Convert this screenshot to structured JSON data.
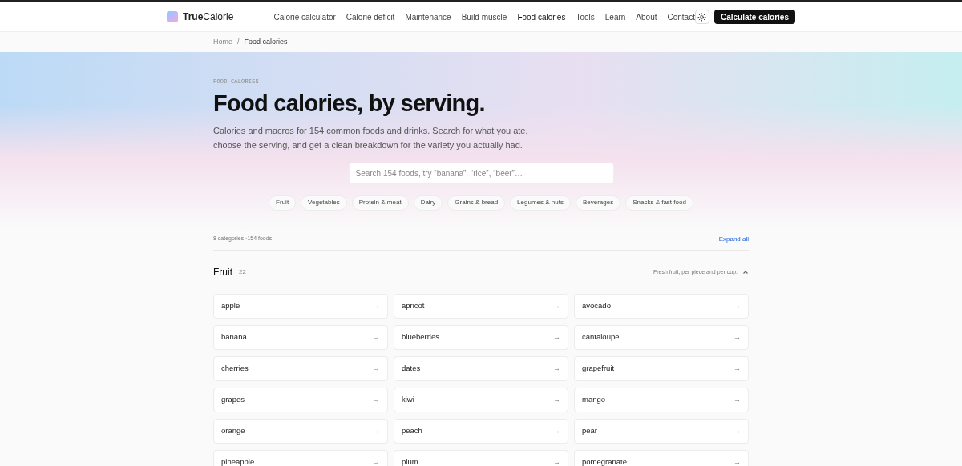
{
  "header": {
    "logo": "**True**Calorie",
    "nav": [
      {
        "label": "Calorie calculator",
        "selected": false
      },
      {
        "label": "Calorie deficit",
        "selected": false
      },
      {
        "label": "Maintenance",
        "selected": false
      },
      {
        "label": "Build muscle",
        "selected": false
      },
      {
        "label": "Food calories",
        "selected": true
      },
      {
        "label": "Tools",
        "selected": false
      },
      {
        "label": "Learn",
        "selected": false
      },
      {
        "label": "About",
        "selected": false
      },
      {
        "label": "Contact",
        "selected": false
      }
    ],
    "cta": "Calculate calories"
  },
  "breadcrumb": [
    "Home",
    "/",
    "Food calories"
  ],
  "hero": {
    "eyebrow": "FOOD CALORIES",
    "title": "Food calories, by serving.",
    "description": "Calories and macros for 154 common foods and drinks. Search for what you ate, choose the serving, and get a clean breakdown for the variety you actually had.",
    "search": {
      "placeholder": "Search 154 foods, try “banana”, “rice”, “beer”…"
    },
    "filters": [
      "Fruit",
      "Vegetables",
      "Protein & meat",
      "Dairy",
      "Grains & bread",
      "Legumes & nuts",
      "Beverages",
      "Snacks & fast food"
    ]
  },
  "summary": {
    "text": "8 categories ·154 foods",
    "action": "Expand all"
  },
  "categories": [
    {
      "name": "Fruit",
      "count": "22",
      "description": "Fresh fruit, per piece and per cup.",
      "expanded": true,
      "items": [
        {
          "label": "apple",
          "arrow": "→"
        },
        {
          "label": "apricot",
          "arrow": "→"
        },
        {
          "label": "avocado",
          "arrow": "→"
        },
        {
          "label": "banana",
          "arrow": "→"
        },
        {
          "label": "blueberries",
          "arrow": "→"
        },
        {
          "label": "cantaloupe",
          "arrow": "→"
        },
        {
          "label": "cherries",
          "arrow": "→"
        },
        {
          "label": "dates",
          "arrow": "→"
        },
        {
          "label": "grapefruit",
          "arrow": "→"
        },
        {
          "label": "grapes",
          "arrow": "→"
        },
        {
          "label": "kiwi",
          "arrow": "→"
        },
        {
          "label": "mango",
          "arrow": "→"
        },
        {
          "label": "orange",
          "arrow": "→"
        },
        {
          "label": "peach",
          "arrow": "→"
        },
        {
          "label": "pear",
          "arrow": "→"
        },
        {
          "label": "pineapple",
          "arrow": "→"
        },
        {
          "label": "plum",
          "arrow": "→"
        },
        {
          "label": "pomegranate",
          "arrow": "→"
        }
      ]
    }
  ]
}
